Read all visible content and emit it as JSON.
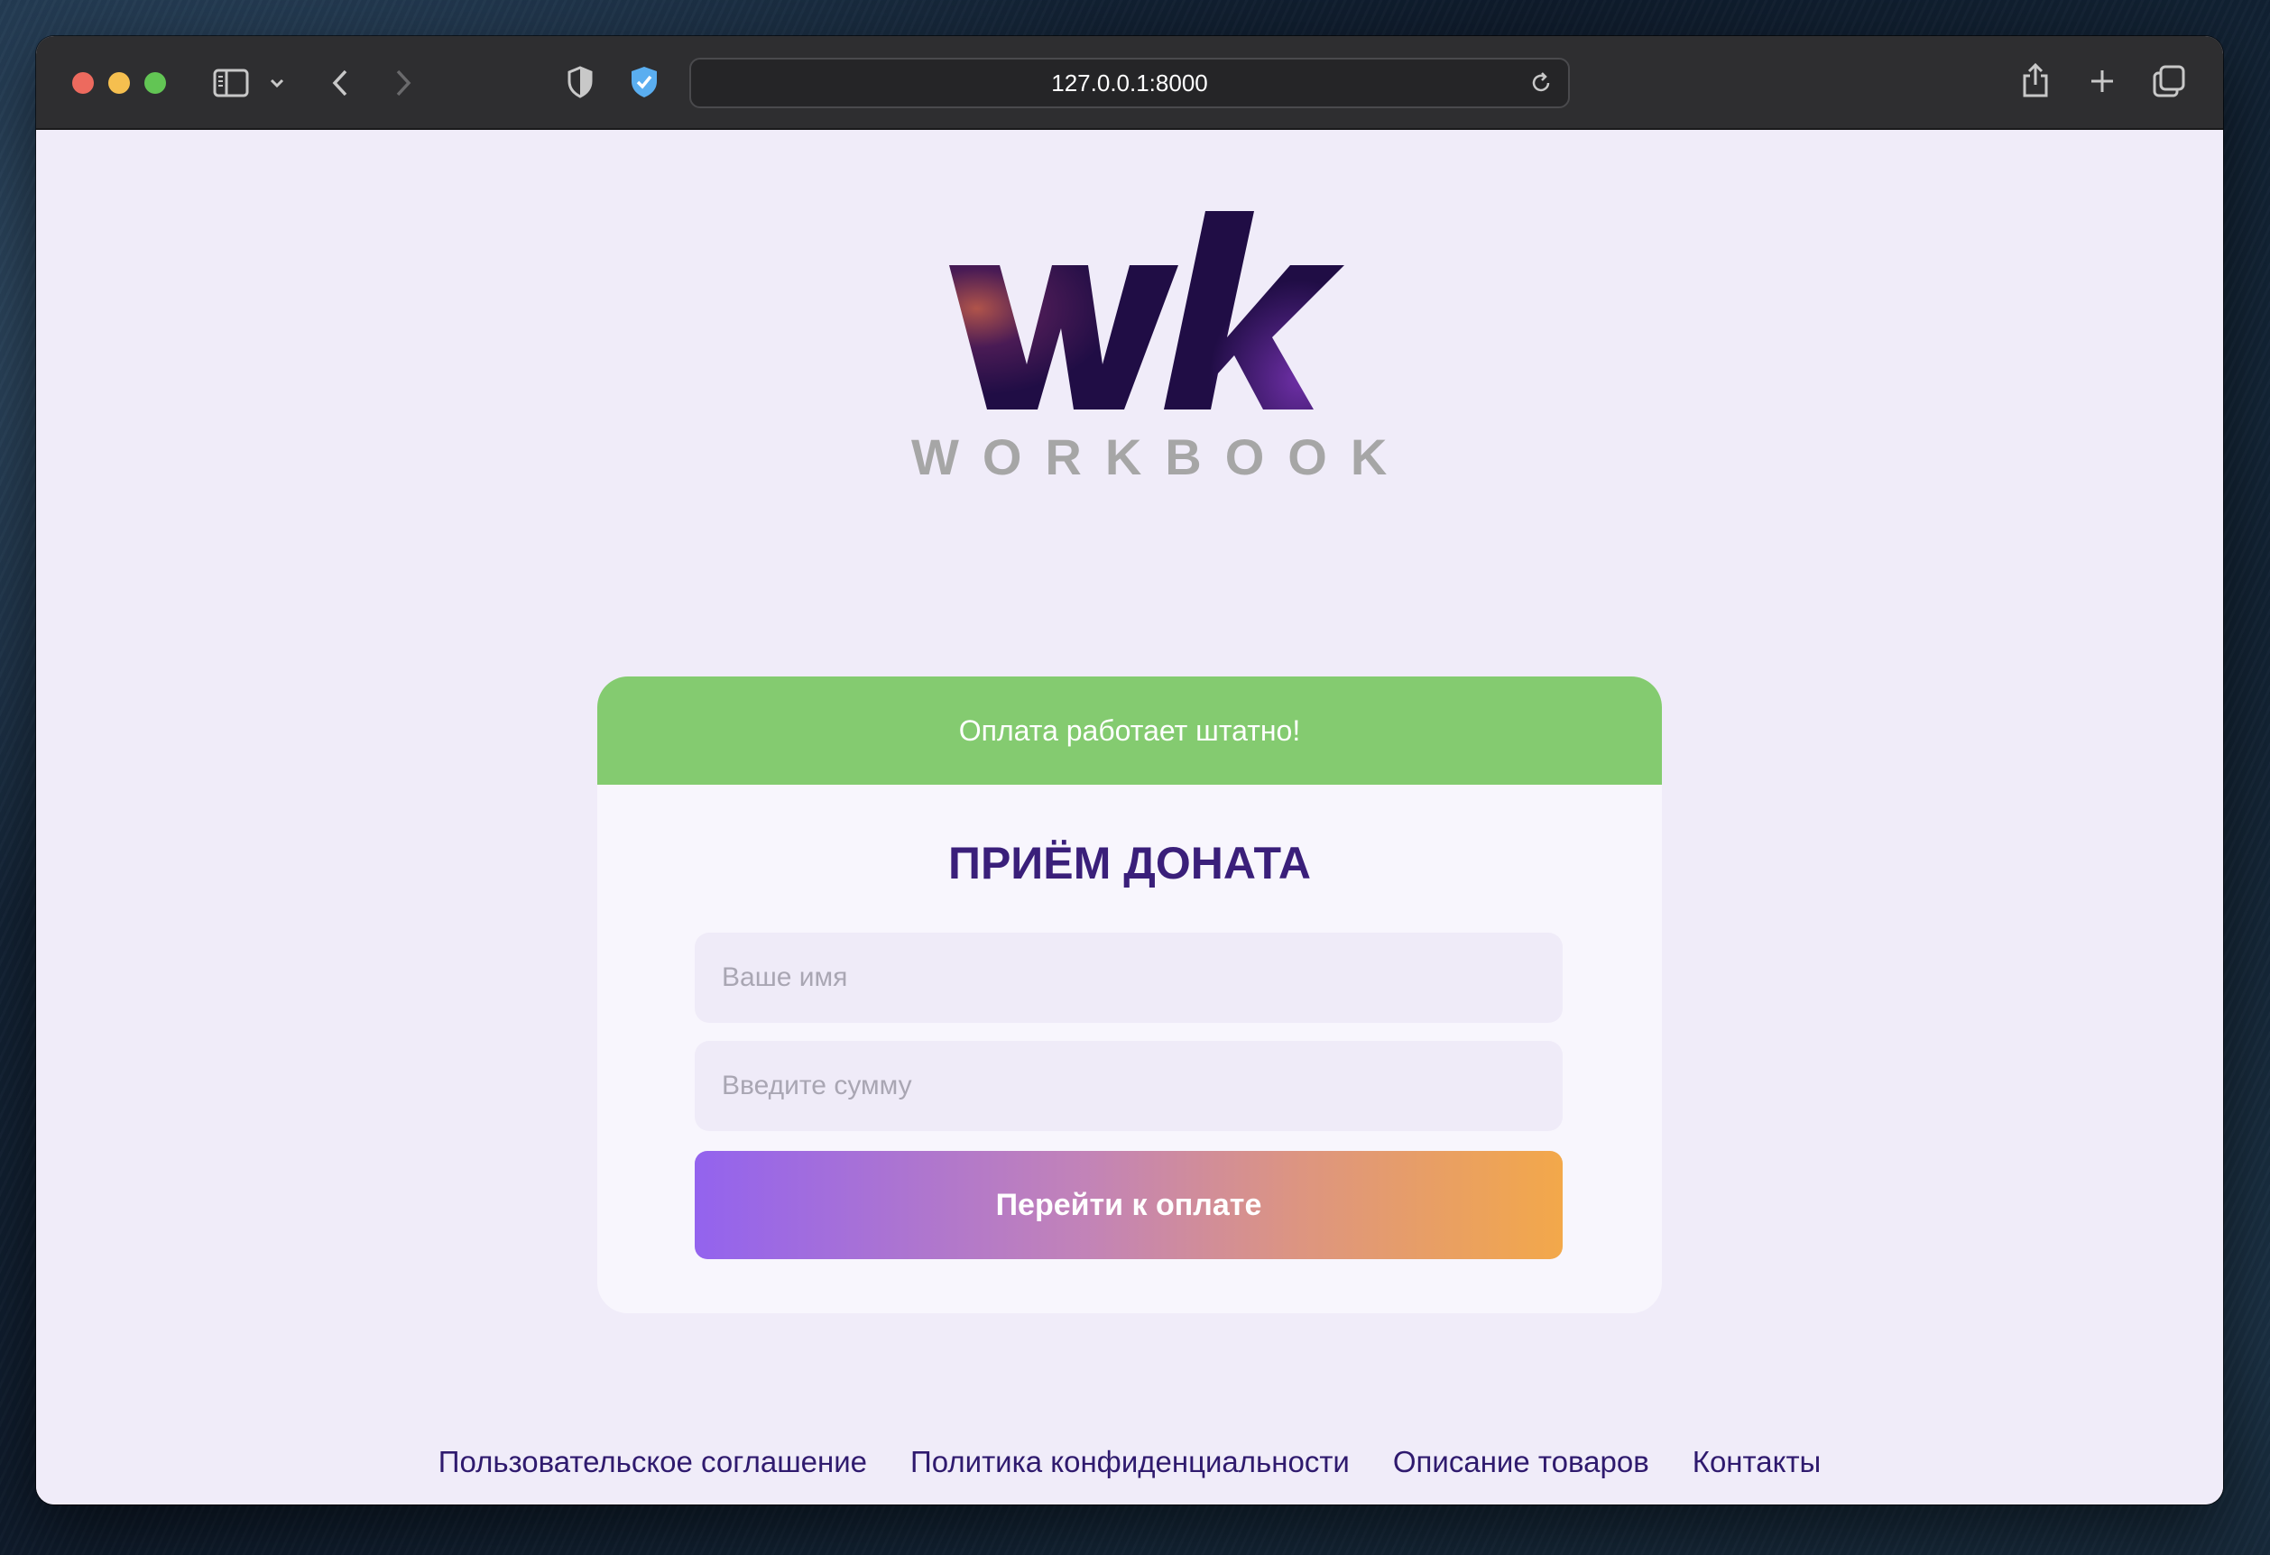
{
  "browser": {
    "url": "127.0.0.1:8000"
  },
  "logo": {
    "mark": "wk",
    "subtitle": "WORKBOOK"
  },
  "status": {
    "message": "Оплата работает штатно!",
    "color": "#84cb70"
  },
  "form": {
    "title": "ПРИЁМ ДОНАТА",
    "name_placeholder": "Ваше имя",
    "amount_placeholder": "Введите сумму",
    "submit_label": "Перейти к оплате"
  },
  "footer": {
    "links": [
      "Пользовательское соглашение",
      "Политика конфиденциальности",
      "Описание товаров",
      "Контакты"
    ]
  },
  "colors": {
    "accent": "#3a1f7a",
    "button_start": "#9363ee",
    "button_end": "#f3a84a"
  }
}
